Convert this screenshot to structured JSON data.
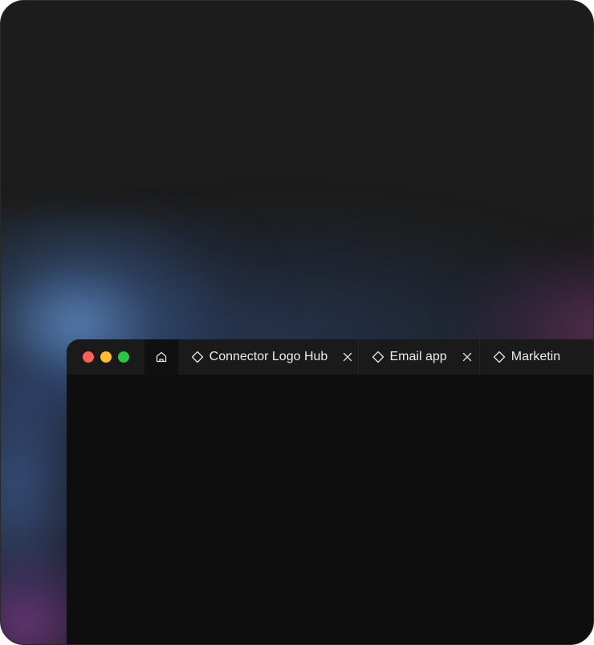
{
  "window": {
    "controls": {
      "close_color": "#ff5f57",
      "minimize_color": "#febc2e",
      "maximize_color": "#28c840"
    },
    "tabs": [
      {
        "label": "",
        "icon": "home-icon",
        "active": true
      },
      {
        "label": "Connector Logo Hub",
        "icon": "diamond-icon",
        "closable": true
      },
      {
        "label": "Email app",
        "icon": "diamond-icon",
        "closable": true
      },
      {
        "label": "Marketin",
        "icon": "diamond-icon",
        "closable": false
      }
    ]
  },
  "colors": {
    "background": "#1c1c1c",
    "tabbar": "#1a1a1a",
    "content": "#0e0e0e",
    "glow_blue": "#608cc8",
    "glow_pink": "#82376e"
  }
}
